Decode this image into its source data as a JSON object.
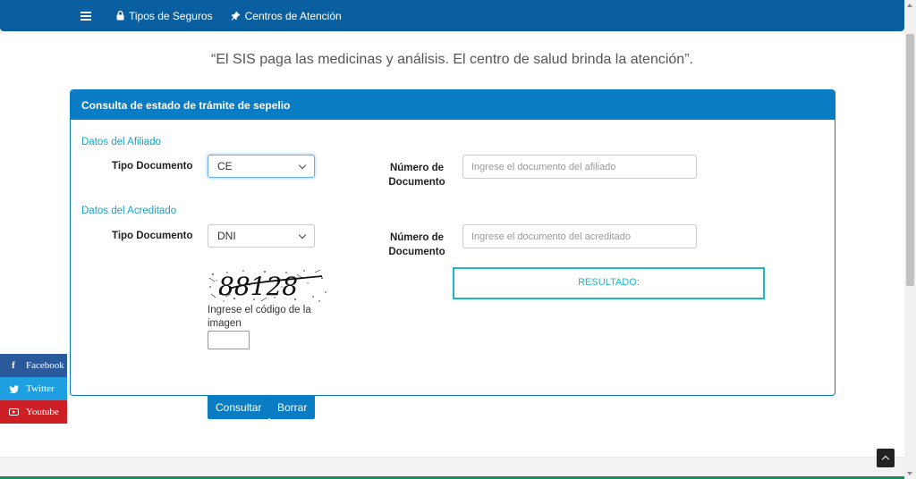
{
  "nav": {
    "menu_icon": "hamburger-icon",
    "items": [
      {
        "label": "Tipos de Seguros",
        "icon": "lock-icon"
      },
      {
        "label": "Centros de Atención",
        "icon": "pin-icon"
      }
    ]
  },
  "quote": "“El SIS paga las medicinas y análisis. El centro de salud brinda la atención”.",
  "panel": {
    "title": "Consulta de estado de trámite de sepelio",
    "afiliado": {
      "section_title": "Datos del Afiliado",
      "tipo_label": "Tipo Documento",
      "tipo_value": "CE",
      "numero_label_1": "Número de",
      "numero_label_2": "Documento",
      "numero_placeholder": "Ingrese el documento del afiliado"
    },
    "acreditado": {
      "section_title": "Datos del Acreditado",
      "tipo_label": "Tipo Documento",
      "tipo_value": "DNI",
      "numero_label_1": "Número de",
      "numero_label_2": "Documento",
      "numero_placeholder": "Ingrese el documento del acreditado"
    },
    "captcha": {
      "code": "88128",
      "label": "Ingrese el código de la imagen"
    },
    "resultado": "RESULTADO:"
  },
  "buttons": {
    "consultar": "Consultar",
    "borrar": "Borrar"
  },
  "social": [
    {
      "label": "Facebook",
      "icon": "facebook-icon",
      "color": "#2a5a9c"
    },
    {
      "label": "Twitter",
      "icon": "twitter-icon",
      "color": "#1ea0e3"
    },
    {
      "label": "Youtube",
      "icon": "youtube-icon",
      "color": "#cc1f26"
    }
  ],
  "colors": {
    "nav": "#0a5fa0",
    "panel": "#0a7cc4",
    "section": "#17a2c8",
    "resultado": "#21b5c8"
  }
}
